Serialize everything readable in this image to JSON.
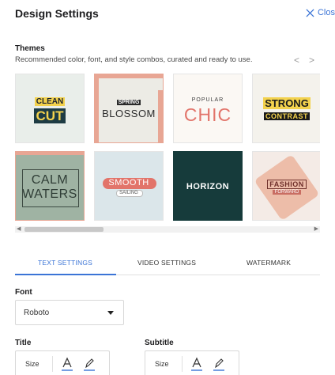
{
  "header": {
    "title": "Design Settings",
    "close_label": "Clos"
  },
  "themes": {
    "label": "Themes",
    "subtitle": "Recommended color, font, and style combos, curated and ready to use.",
    "prev_glyph": "<",
    "next_glyph": ">",
    "tiles": [
      {
        "line1": "CLEAN",
        "line2": "CUT"
      },
      {
        "line1": "SPRING",
        "line2": "BLOSSOM"
      },
      {
        "line1": "POPULAR",
        "line2": "CHIC"
      },
      {
        "line1": "STRONG",
        "line2": "CONTRAST"
      },
      {
        "line1": "CALM",
        "line2": "WATERS"
      },
      {
        "line1": "SMOOTH",
        "line2": "SAILING"
      },
      {
        "line1": "HORIZON"
      },
      {
        "line1": "FASHION",
        "line2": "FORWARD"
      }
    ]
  },
  "scroll": {
    "left_glyph": "◀",
    "right_glyph": "▶"
  },
  "tabs": [
    {
      "label": "TEXT SETTINGS",
      "active": true
    },
    {
      "label": "VIDEO SETTINGS",
      "active": false
    },
    {
      "label": "WATERMARK",
      "active": false
    }
  ],
  "font": {
    "label": "Font",
    "selected": "Roboto"
  },
  "title_section": {
    "label": "Title",
    "size_label": "Size",
    "icons": [
      "text-color-icon",
      "highlight-pen-icon"
    ]
  },
  "subtitle_section": {
    "label": "Subtitle",
    "size_label": "Size",
    "icons": [
      "text-color-icon",
      "highlight-pen-icon"
    ]
  },
  "colors": {
    "accent": "#3b74d6",
    "yellow": "#f3d24d",
    "coral": "#e2746a",
    "teal_dark": "#163b3b"
  }
}
